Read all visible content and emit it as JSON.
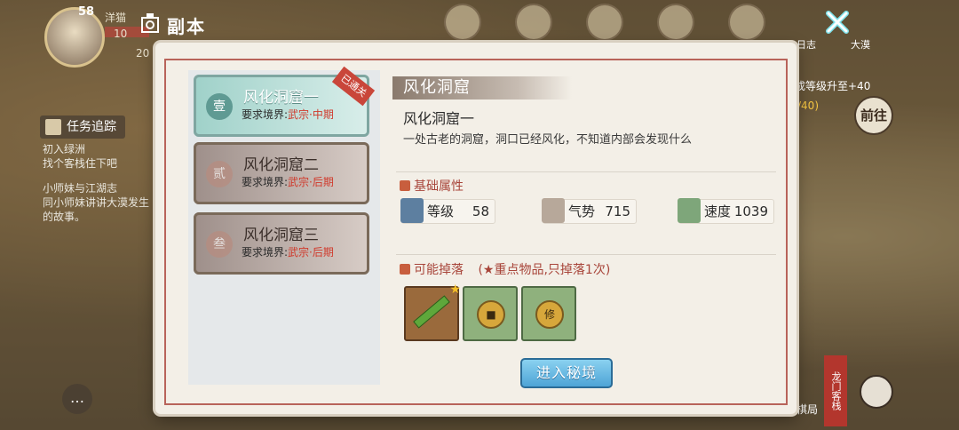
{
  "hud": {
    "level": "58",
    "name": "洋猫",
    "num1": "10",
    "num2": "20",
    "title": "副本",
    "top_label_1": "日志",
    "top_label_2": "大漠"
  },
  "left_side": {
    "task_button": "任务追踪",
    "quests": [
      {
        "title": "初入绿洲",
        "desc": "找个客栈住下吧"
      },
      {
        "title": "小师妹与江湖志",
        "desc": "同小师妹讲讲大漠发生的故事。"
      }
    ]
  },
  "right_side": {
    "upgrade_text": "成等级升至+40",
    "progress_text": "/40)",
    "goto_label": "前往",
    "shop_sign": "龙门客栈",
    "chess_label": "棋局"
  },
  "stages": [
    {
      "badge": "壹",
      "name": "风化洞窟一",
      "req_label": "要求境界:",
      "req_value": "武宗·中期",
      "selected": true,
      "cleared_tag": "已通关"
    },
    {
      "badge": "贰",
      "name": "风化洞窟二",
      "req_label": "要求境界:",
      "req_value": "武宗·后期",
      "selected": false
    },
    {
      "badge": "叁",
      "name": "风化洞窟三",
      "req_label": "要求境界:",
      "req_value": "武宗·后期",
      "selected": false
    }
  ],
  "detail": {
    "section_title": "风化洞窟",
    "stage_name": "风化洞窟一",
    "description": "一处古老的洞窟，洞口已经风化，不知道内部会发现什么",
    "attributes_title": "基础属性",
    "stats": [
      {
        "label": "等级",
        "value": "58",
        "icon": "level-icon"
      },
      {
        "label": "气势",
        "value": "715",
        "icon": "momentum-icon"
      },
      {
        "label": "速度",
        "value": "1039",
        "icon": "speed-icon"
      }
    ],
    "drops_title": "可能掉落",
    "drops_note": "(★重点物品,只掉落1次)",
    "drops": [
      {
        "icon": "green-sword-icon",
        "key_item": true
      },
      {
        "icon": "coin-icon",
        "key_item": false
      },
      {
        "icon": "cultivation-coin-icon",
        "glyph": "修",
        "key_item": false
      }
    ],
    "enter_button": "进入秘境"
  },
  "colors": {
    "accent_red": "#d0392b",
    "enter_button": "#4ea4d6",
    "selected_stage": "#9fd1c9"
  }
}
